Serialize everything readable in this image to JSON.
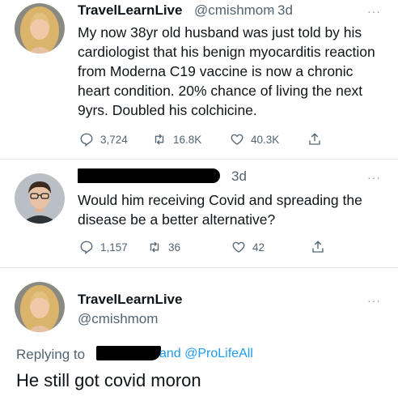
{
  "tweets": [
    {
      "name": "TravelLearnLive",
      "handle": "@cmishmom",
      "sep": "·",
      "time": "3d",
      "more": "···",
      "text": "My now 38yr old husband was just told by his cardiologist that his benign myocarditis reaction from Moderna C19 vaccine is now a chronic heart condition. 20% chance of living the next 9yrs. Doubled his colchicine.",
      "replies": "3,724",
      "retweets": "16.8K",
      "likes": "40.3K"
    },
    {
      "time": "3d",
      "more": "···",
      "text": "Would him receiving Covid and spreading the disease be a better alternative?",
      "replies": "1,157",
      "retweets": "36",
      "likes": "42"
    }
  ],
  "reply": {
    "name": "TravelLearnLive",
    "handle": "@cmishmom",
    "more": "···",
    "replying_label": "Replying to",
    "replying_targets": "and @ProLifeAll",
    "text": "He still got covid moron"
  },
  "colors": {
    "link": "#1d9bf0",
    "muted": "#536471",
    "text": "#0f1419"
  }
}
